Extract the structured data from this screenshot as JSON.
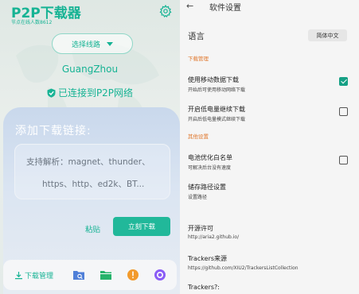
{
  "left": {
    "app_title": "P2P下载器",
    "online_count": "节点在线人数8612",
    "route_button": "选择线路",
    "city": "GuangZhou",
    "connection_status": "已连接到P2P网络",
    "add_link_title": "添加下载链接:",
    "input_placeholder_line1": "支持解析：magnet、thunder、",
    "input_placeholder_line2": "https、http、ed2k、BT...",
    "paste_label": "粘贴",
    "download_now_label": "立刻下载",
    "download_manager_label": "下载管理",
    "icons": [
      "gear-icon",
      "caret-down-icon",
      "shield-check-icon",
      "download-icon",
      "folder-search-icon",
      "folder-icon",
      "info-icon",
      "circle-icon"
    ],
    "colors": {
      "accent": "#16b394",
      "folder_blue": "#4f7fd8",
      "folder_green": "#26b36b",
      "info_orange": "#f29a2c",
      "circle_purple": "#8a5cf6"
    }
  },
  "right": {
    "title": "软件设置",
    "language_label": "语言",
    "language_value": "简体中文",
    "section_download": "下载管理",
    "items": [
      {
        "title": "使用移动数据下载",
        "subtitle": "开始后可使用移动网络下载",
        "checked": true
      },
      {
        "title": "开启低电量继续下载",
        "subtitle": "开启后低电量模式继续下载",
        "checked": false
      }
    ],
    "section_other": "其他设置",
    "battery": {
      "title": "电池优化白名单",
      "subtitle": "可解决后台没有速度",
      "checked": false
    },
    "storage": {
      "title": "储存路径设置",
      "subtitle": "设置路径"
    },
    "license": {
      "title": "开源许可",
      "subtitle": "http://aria2.github.io/"
    },
    "trackers_source": {
      "title": "Trackers来源",
      "subtitle": "https://github.com/XIU2/TrackersListCollection"
    },
    "trackers_q": {
      "title": "Trackers?:"
    }
  }
}
